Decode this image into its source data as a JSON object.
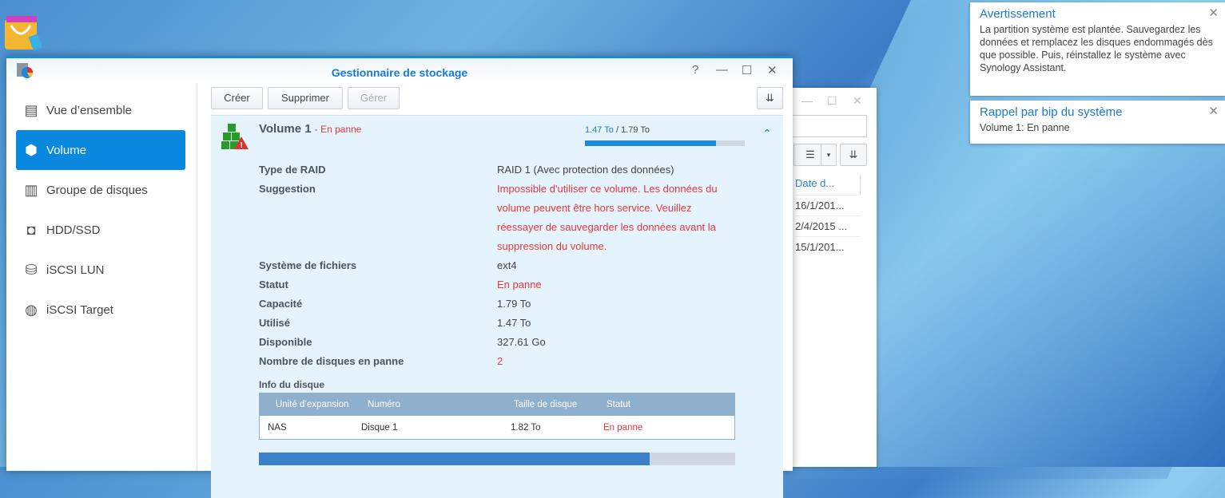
{
  "window": {
    "title": "Gestionnaire de stockage"
  },
  "sidebar": {
    "items": [
      {
        "label": "Vue d’ensemble",
        "icon": "overview-icon"
      },
      {
        "label": "Volume",
        "icon": "volume-icon",
        "active": true
      },
      {
        "label": "Groupe de disques",
        "icon": "disk-group-icon"
      },
      {
        "label": "HDD/SSD",
        "icon": "hdd-icon"
      },
      {
        "label": "iSCSI LUN",
        "icon": "iscsi-lun-icon"
      },
      {
        "label": "iSCSI Target",
        "icon": "iscsi-target-icon"
      }
    ]
  },
  "toolbar": {
    "create": "Créer",
    "delete": "Supprimer",
    "manage": "Gérer"
  },
  "volume": {
    "name": "Volume 1",
    "status_suffix": "- En panne",
    "used": "1.47 To",
    "sep": " / ",
    "total": "1.79 To",
    "usage_fraction": 0.82,
    "details": [
      {
        "label": "Type de RAID",
        "value": "RAID 1 (Avec protection des données)"
      },
      {
        "label": "Suggestion",
        "value": "Impossible d'utiliser ce volume. Les données du volume peuvent être hors service. Veuillez réessayer de sauvegarder les données avant la suppression du volume."
      },
      {
        "label": "Système de fichiers",
        "value": "ext4"
      },
      {
        "label": "Statut",
        "value": "En panne"
      },
      {
        "label": "Capacité",
        "value": "1.79 To"
      },
      {
        "label": "Utilisé",
        "value": "1.47 To"
      },
      {
        "label": "Disponible",
        "value": "327.61 Go"
      },
      {
        "label": "Nombre de disques en panne",
        "value": "2"
      }
    ],
    "disk_info_title": "Info du disque",
    "disk_table": {
      "headers": [
        "Unité d’expansion",
        "Numéro",
        "Taille de disque",
        "Statut"
      ],
      "rows": [
        [
          "NAS",
          "Disque 1",
          "1.82 To",
          "En panne"
        ]
      ]
    },
    "bottom_bar_fraction": 0.82
  },
  "background_window": {
    "column_header": "Date d...",
    "rows": [
      "16/1/201...",
      "2/4/2015 ...",
      "15/1/201..."
    ]
  },
  "notifications": [
    {
      "title": "Avertissement",
      "body": "La partition système est plantée. Sauvegardez les données et remplacez les disques endommagés dès que possible. Puis, réinstallez le système avec Synology Assistant."
    },
    {
      "title": "Rappel par bip du système",
      "body": "Volume 1: En panne"
    }
  ]
}
